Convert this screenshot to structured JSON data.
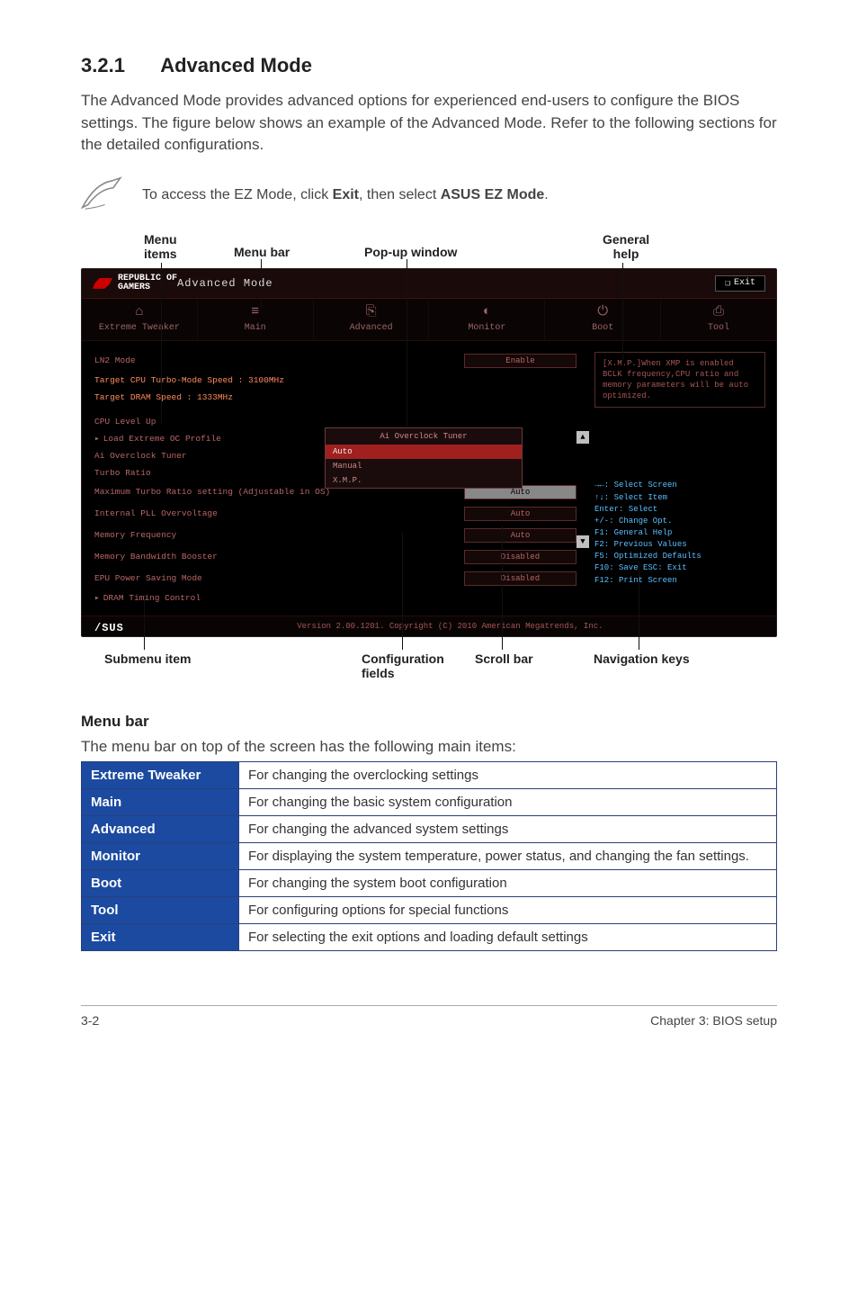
{
  "section": {
    "number": "3.2.1",
    "title": "Advanced Mode"
  },
  "intro": "The Advanced Mode provides advanced options for experienced end-users to configure the BIOS settings. The figure below shows an example of the Advanced Mode. Refer to the following sections for the detailed configurations.",
  "note": {
    "pre": "To access the EZ Mode, click ",
    "b1": "Exit",
    "mid": ", then select ",
    "b2": "ASUS EZ Mode",
    "post": "."
  },
  "callouts": {
    "menu_items": "Menu\nitems",
    "menu_bar": "Menu bar",
    "popup": "Pop-up window",
    "general_help": "General\nhelp",
    "submenu": "Submenu item",
    "config_fields": "Configuration\nfields",
    "scrollbar": "Scroll bar",
    "navkeys": "Navigation keys"
  },
  "fig": {
    "logo_top": "REPUBLIC OF",
    "logo_bot": "GAMERS",
    "mode": "Advanced Mode",
    "exit": "Exit",
    "nav": [
      {
        "icon": "⌂",
        "label": "Extreme Tweaker"
      },
      {
        "icon": "≡",
        "label": "Main"
      },
      {
        "icon": "⎘",
        "label": "Advanced"
      },
      {
        "icon": "◐",
        "label": "Monitor"
      },
      {
        "icon": "⏻",
        "label": "Boot"
      },
      {
        "icon": "⎙",
        "label": "Tool"
      }
    ],
    "help_text": "[X.M.P.]When XMP is enabled BCLK frequency,CPU ratio and memory parameters will be auto optimized.",
    "navkeys": [
      "→←: Select Screen",
      "↑↓: Select Item",
      "Enter: Select",
      "+/-: Change Opt.",
      "F1: General Help",
      "F2: Previous Values",
      "F5: Optimized Defaults",
      "F10: Save  ESC: Exit",
      "F12: Print Screen"
    ],
    "rows": {
      "ln2": {
        "label": "LN2 Mode",
        "value": "Enable"
      },
      "turbo_speed": "Target CPU Turbo-Mode Speed : 3100MHz",
      "dram_speed": "Target DRAM Speed : 1333MHz",
      "cpu_level": "CPU Level Up",
      "load_profile": "Load Extreme OC Profile",
      "ai_tuner": "Ai Overclock Tuner",
      "turbo_ratio": "Turbo Ratio",
      "max_turbo": {
        "label": "Maximum Turbo Ratio setting (Adjustable in OS)",
        "value": "Auto"
      },
      "pll": {
        "label": "Internal PLL Overvoltage",
        "value": "Auto"
      },
      "mem_freq": {
        "label": "Memory Frequency",
        "value": "Auto"
      },
      "mem_bw": {
        "label": "Memory Bandwidth Booster",
        "value": "Disabled"
      },
      "epu": {
        "label": "EPU Power Saving Mode",
        "value": "Disabled"
      },
      "dram_ctl": "DRAM Timing Control"
    },
    "popup": {
      "title": "Ai Overclock Tuner",
      "opts": [
        "Auto",
        "Manual",
        "X.M.P."
      ]
    },
    "footer": "Version 2.00.1201. Copyright (C) 2010 American Megatrends, Inc.",
    "asus": "/SUS"
  },
  "menubar": {
    "heading": "Menu bar",
    "intro": "The menu bar on top of the screen has the following main items:",
    "rows": [
      {
        "name": "Extreme Tweaker",
        "desc": "For changing the overclocking settings"
      },
      {
        "name": "Main",
        "desc": "For changing the basic system configuration"
      },
      {
        "name": "Advanced",
        "desc": "For changing the advanced system settings"
      },
      {
        "name": "Monitor",
        "desc": "For displaying the system temperature, power status, and changing the fan settings."
      },
      {
        "name": "Boot",
        "desc": "For changing the system boot configuration"
      },
      {
        "name": "Tool",
        "desc": "For configuring options for special functions"
      },
      {
        "name": "Exit",
        "desc": "For selecting the exit options and loading default settings"
      }
    ]
  },
  "footer": {
    "left": "3-2",
    "right": "Chapter 3: BIOS setup"
  }
}
